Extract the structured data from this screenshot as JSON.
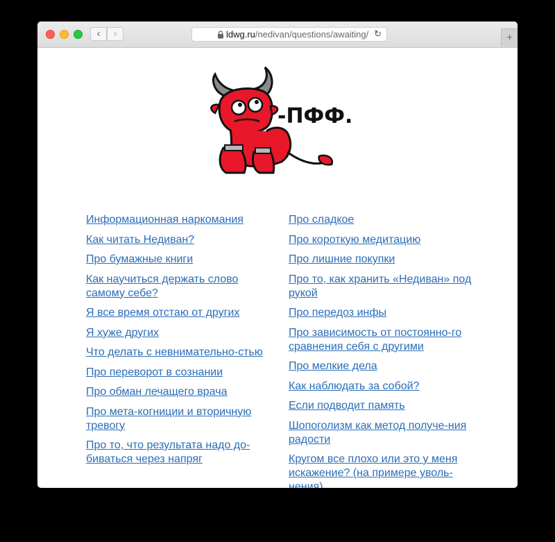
{
  "browser": {
    "url_domain": "ldwg.ru",
    "url_path": "/nedivan/questions/awaiting/",
    "back_glyph": "‹",
    "forward_glyph": "›",
    "reload_glyph": "↻",
    "new_tab_glyph": "+"
  },
  "logo": {
    "text": "-ПФФ.",
    "accent_color": "#e8182a"
  },
  "questions": {
    "left": [
      "Информационная наркомания",
      "Как читать Недиван?",
      "Про бумажные книги",
      "Как научиться держать слово самому себе?",
      "Я все время отстаю от других",
      "Я хуже других",
      "Что делать с невнимательно-стью",
      "Про переворот в сознании",
      "Про обман лечащего врача",
      "Про мета-когниции и вторичную тревогу",
      "Про то, что результата надо до-биваться через напряг"
    ],
    "right": [
      "Про сладкое",
      "Про короткую медитацию",
      "Про лишние покупки",
      "Про то, как хранить «Недиван» под рукой",
      "Про передоз инфы",
      "Про зависимость от постоянно-го сравнения себя с другими",
      "Про мелкие дела",
      "Как наблюдать за собой?",
      "Если подводит память",
      "Шопоголизм как метод получе-ния радости",
      "Кругом все плохо или это у меня искажение? (на примере уволь-нения)"
    ]
  },
  "colors": {
    "link": "#2a6db8"
  }
}
